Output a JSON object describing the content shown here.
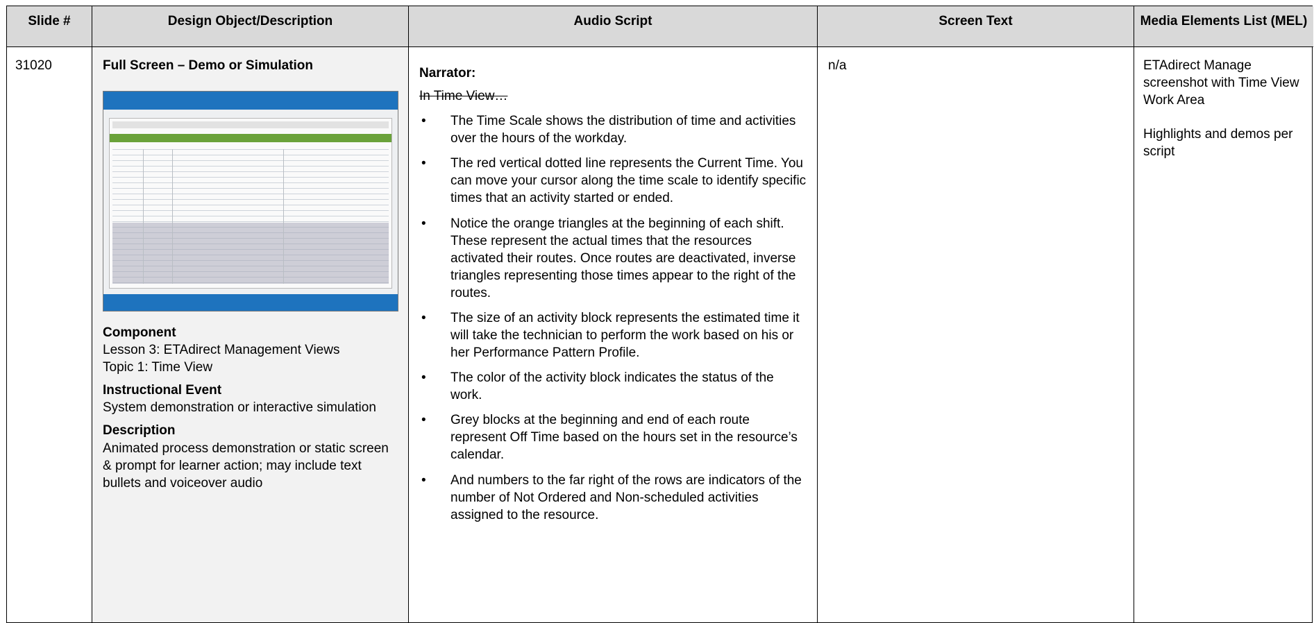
{
  "headers": {
    "slide": "Slide #",
    "design": "Design Object/Description",
    "audio": "Audio Script",
    "screen_text": "Screen Text",
    "mel": "Media Elements List (MEL)"
  },
  "row": {
    "slide_number": "31020",
    "design": {
      "title": "Full Screen – Demo or Simulation",
      "component_heading": "Component",
      "component_line1": "Lesson 3: ETAdirect Management Views",
      "component_line2": "Topic 1: Time View",
      "event_heading": "Instructional Event",
      "event_text": "System demonstration or interactive simulation",
      "description_heading": "Description",
      "description_text": "Animated process demonstration or static screen & prompt for learner action; may include text bullets and voiceover audio"
    },
    "audio": {
      "narrator": "Narrator:",
      "struck_line": "In Time View…",
      "bullets": [
        "The Time Scale shows the distribution of time and activities over the hours of the workday.",
        "The red vertical dotted line represents the Current Time. You can move your cursor along the time scale to identify specific times that an activity started or ended.",
        "Notice the orange triangles at the beginning of each shift.  These represent the actual times that the resources activated their routes.  Once routes are deactivated, inverse triangles representing those times appear to the right of the routes.",
        "The size of an activity block represents the estimated time it will take the technician to perform the work based on his or her Performance Pattern Profile.",
        "The color of the activity block indicates the status of the work.",
        "Grey blocks at the beginning and end of each route represent Off Time based on the hours set in the resource’s calendar.",
        "And numbers to the far right of the rows are indicators of the number of Not Ordered and Non-scheduled activities assigned to the resource."
      ]
    },
    "screen_text": "n/a",
    "mel": {
      "item1": "ETAdirect Manage screenshot with Time View Work Area",
      "item2": "Highlights and demos per script"
    }
  }
}
